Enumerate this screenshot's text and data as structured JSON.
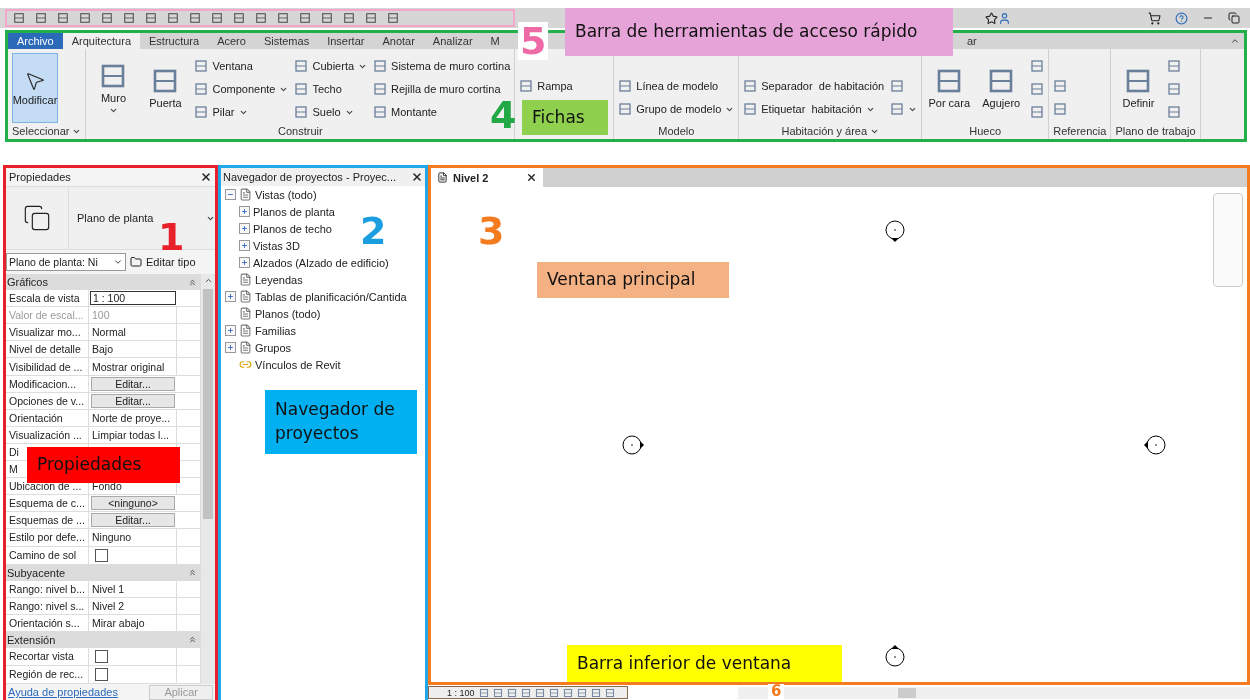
{
  "quick_access_toolbar": {
    "callout_number": "5",
    "callout": "Barra de herramientas de acceso rápido"
  },
  "ribbon": {
    "callout_number": "4",
    "callout": "Fichas",
    "tabs": [
      {
        "label": "Archivo",
        "kind": "file",
        "selected": false
      },
      {
        "label": "Arquitectura",
        "kind": "tab",
        "selected": true
      },
      {
        "label": "Estructura",
        "kind": "tab",
        "selected": false
      },
      {
        "label": "Acero",
        "kind": "tab",
        "selected": false
      },
      {
        "label": "Sistemas",
        "kind": "tab",
        "selected": false
      },
      {
        "label": "Insertar",
        "kind": "tab",
        "selected": false
      },
      {
        "label": "Anotar",
        "kind": "tab",
        "selected": false
      },
      {
        "label": "Analizar",
        "kind": "tab",
        "selected": false
      },
      {
        "label": "M",
        "kind": "tab",
        "selected": false
      }
    ],
    "tabs_after_callout": [
      {
        "label": "ar",
        "selected": false
      }
    ],
    "panels": [
      {
        "label": "Seleccionar",
        "dropdown": true,
        "columns": [
          [
            {
              "label": "Modificar",
              "kind": "large",
              "dropdown": false,
              "selected": true
            }
          ]
        ]
      },
      {
        "label": "Construir",
        "dropdown": false,
        "columns": [
          [
            {
              "label": "Muro",
              "kind": "large",
              "dropdown": true,
              "selected": false
            }
          ],
          [
            {
              "label": "Puerta",
              "kind": "large",
              "dropdown": false,
              "selected": false
            }
          ],
          [
            {
              "label": "Ventana",
              "kind": "small",
              "dropdown": false,
              "selected": false
            },
            {
              "label": "Componente",
              "kind": "small",
              "dropdown": true,
              "selected": false
            },
            {
              "label": "Pilar",
              "kind": "small",
              "dropdown": true,
              "selected": false
            }
          ],
          [
            {
              "label": "Cubierta",
              "kind": "small",
              "dropdown": true,
              "selected": false
            },
            {
              "label": "Techo",
              "kind": "small",
              "dropdown": false,
              "selected": false
            },
            {
              "label": "Suelo",
              "kind": "small",
              "dropdown": true,
              "selected": false
            }
          ],
          [
            {
              "label": "Sistema de muro cortina",
              "kind": "small",
              "dropdown": false,
              "selected": false
            },
            {
              "label": "Rejilla de muro cortina",
              "kind": "small",
              "dropdown": false,
              "selected": false
            },
            {
              "label": "Montante",
              "kind": "small",
              "dropdown": false,
              "selected": false
            }
          ]
        ]
      },
      {
        "columns": [
          [
            {
              "label": "Rampa",
              "kind": "small",
              "dropdown": false,
              "selected": false
            }
          ]
        ]
      },
      {
        "label": "Modelo",
        "dropdown": false,
        "columns": [
          [
            {
              "label": "Línea de modelo",
              "kind": "small",
              "dropdown": false,
              "selected": false
            },
            {
              "label": "Grupo de modelo",
              "kind": "small",
              "dropdown": true,
              "selected": false
            }
          ]
        ]
      },
      {
        "label": "Habitación y área",
        "dropdown": true,
        "columns": [
          [
            {
              "label": "Separador  de habitación",
              "kind": "small",
              "dropdown": false,
              "selected": false
            },
            {
              "label": "Etiquetar  habitación",
              "kind": "small",
              "dropdown": true,
              "selected": false
            }
          ],
          [
            {
              "kind": "small",
              "dropdown": false,
              "selected": false
            },
            {
              "kind": "small",
              "dropdown": true,
              "selected": false
            }
          ]
        ]
      },
      {
        "label": "Hueco",
        "dropdown": false,
        "columns": [
          [
            {
              "label": "Por cara",
              "kind": "large",
              "dropdown": false,
              "selected": false
            }
          ],
          [
            {
              "label": "Agujero",
              "kind": "large",
              "dropdown": false,
              "selected": false
            }
          ],
          [
            {
              "kind": "small",
              "dropdown": false,
              "selected": false
            },
            {
              "kind": "small",
              "dropdown": false,
              "selected": false
            },
            {
              "kind": "small",
              "dropdown": false,
              "selected": false
            }
          ]
        ]
      },
      {
        "label": "Referencia",
        "dropdown": false,
        "columns": [
          [
            {
              "kind": "small",
              "dropdown": false,
              "selected": false
            },
            {
              "kind": "small",
              "dropdown": false,
              "selected": false
            }
          ]
        ]
      },
      {
        "label": "Plano de trabajo",
        "dropdown": false,
        "columns": [
          [
            {
              "label": "Definir",
              "kind": "large",
              "dropdown": false,
              "selected": false
            }
          ],
          [
            {
              "kind": "small",
              "dropdown": false,
              "selected": false
            },
            {
              "kind": "small",
              "dropdown": false,
              "selected": false
            },
            {
              "kind": "small",
              "dropdown": false,
              "selected": false
            }
          ]
        ]
      }
    ]
  },
  "properties": {
    "title": "Propiedades",
    "callout_number": "1",
    "callout": "Propiedades",
    "type_name": "Plano de planta",
    "instance_selector": "Plano de planta: Ni",
    "edit_type": "Editar tipo",
    "sections": [
      {
        "title": "Gráficos",
        "rows": [
          {
            "label": "Escala de vista",
            "value": "1 : 100",
            "kind": "input"
          },
          {
            "label": "Valor de escal...",
            "value": "100",
            "kind": "disabled"
          },
          {
            "label": "Visualizar mo...",
            "value": "Normal",
            "kind": "text"
          },
          {
            "label": "Nivel de detalle",
            "value": "Bajo",
            "kind": "text"
          },
          {
            "label": "Visibilidad de ...",
            "value": "Mostrar original",
            "kind": "text"
          },
          {
            "label": "Modificacion...",
            "value": "Editar...",
            "kind": "button"
          },
          {
            "label": "Opciones de v...",
            "value": "Editar...",
            "kind": "button"
          },
          {
            "label": "Orientación",
            "value": "Norte de proye...",
            "kind": "text"
          },
          {
            "label": "Visualización ...",
            "value": "Limpiar todas l...",
            "kind": "text"
          },
          {
            "label": "Di",
            "kind": "text"
          },
          {
            "label": "M",
            "kind": "text"
          },
          {
            "label": "Ubicación de ...",
            "value": "Fondo",
            "kind": "text"
          },
          {
            "label": "Esquema de c...",
            "value": "<ninguno>",
            "kind": "button"
          },
          {
            "label": "Esquemas de ...",
            "value": "Editar...",
            "kind": "button"
          },
          {
            "label": "Estilo por defe...",
            "value": "Ninguno",
            "kind": "text"
          },
          {
            "label": "Camino de sol",
            "kind": "check",
            "checked": false
          }
        ]
      },
      {
        "title": "Subyacente",
        "rows": [
          {
            "label": "Rango: nivel b...",
            "value": "Nivel 1",
            "kind": "text"
          },
          {
            "label": "Rango: nivel s...",
            "value": "Nivel 2",
            "kind": "text"
          },
          {
            "label": "Orientación s...",
            "value": "Mirar abajo",
            "kind": "text"
          }
        ]
      },
      {
        "title": "Extensión",
        "rows": [
          {
            "label": "Recortar vista",
            "kind": "check",
            "checked": false
          },
          {
            "label": "Región de rec...",
            "kind": "check",
            "checked": false
          }
        ]
      }
    ],
    "help_link": "Ayuda de propiedades",
    "apply": {
      "label": "Aplicar",
      "disabled": true
    }
  },
  "project_browser": {
    "title": "Navegador de proyectos - Proyec...",
    "callout_number": "2",
    "callout": "Navegador de proyectos",
    "tree": [
      {
        "label": "Vistas (todo)",
        "expanded": true,
        "children": [
          {
            "label": "Planos de planta",
            "expanded": false
          },
          {
            "label": "Planos de techo",
            "expanded": false
          },
          {
            "label": "Vistas 3D",
            "expanded": false
          },
          {
            "label": "Alzados (Alzado de edificio)",
            "expanded": false
          }
        ]
      },
      {
        "label": "Leyendas"
      },
      {
        "label": "Tablas de planificación/Cantida",
        "expanded": false
      },
      {
        "label": "Planos (todo)"
      },
      {
        "label": "Familias",
        "expanded": false
      },
      {
        "label": "Grupos",
        "expanded": false
      },
      {
        "label": "Vínculos de Revit",
        "kind": "link"
      }
    ]
  },
  "main_window": {
    "callout_number": "3",
    "callout": "Ventana principal",
    "tabs": [
      {
        "label": "Nivel 2",
        "selected": true
      }
    ]
  },
  "view_bar": {
    "scale": "1 : 100",
    "callout_number": "6",
    "callout": "Barra inferior de ventana"
  }
}
